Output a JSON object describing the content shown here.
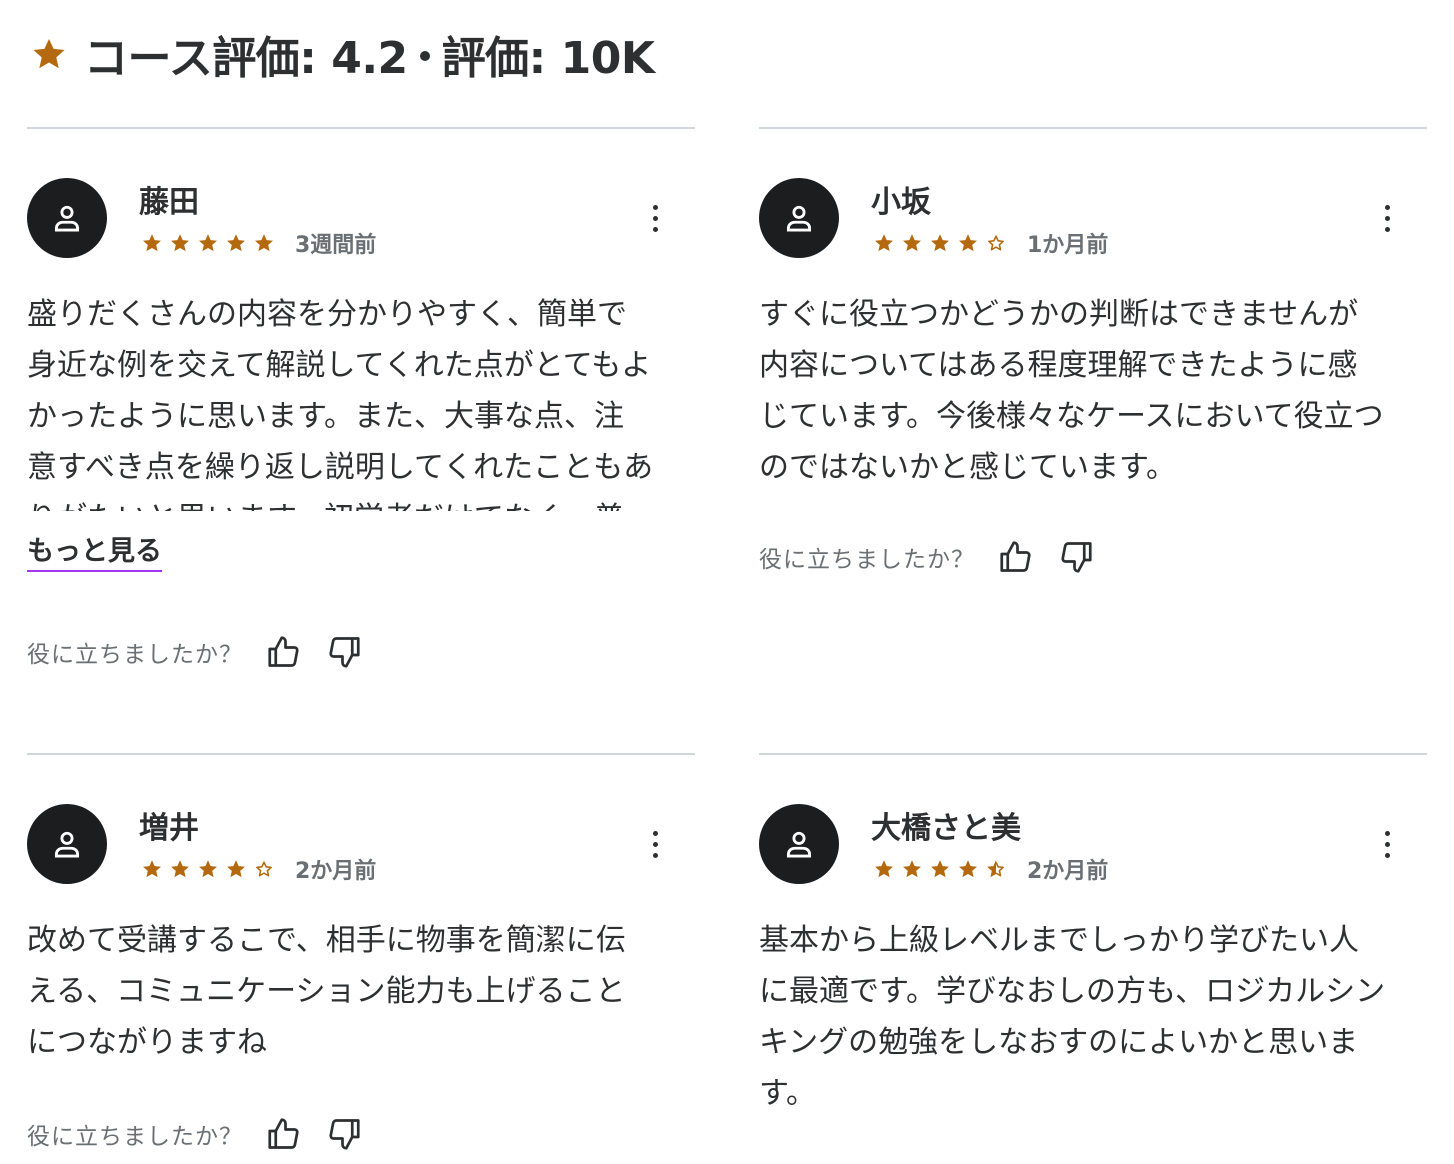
{
  "header": {
    "title_rating": "コース評価: 4.2",
    "title_count": "評価: 10K"
  },
  "colors": {
    "star": "#b4690e",
    "avatar_bg": "#1c1d1f",
    "link_underline": "#a435f0"
  },
  "reviews": [
    {
      "name": "藤田",
      "rating": 5,
      "date": "3週間前",
      "body": "盛りだくさんの内容を分かりやすく、簡単で\n身近な例を交えて解説してくれた点がとてもよ\nかったように思います。また、大事な点、注\n意すべき点を繰り返し説明してくれたこともあ\nりがたいと思います。初学者だけでなく、普",
      "show_more": "もっと見る",
      "helpful_label": "役に立ちましたか？"
    },
    {
      "name": "小坂",
      "rating": 4,
      "date": "1か月前",
      "body": "すぐに役立つかどうかの判断はできませんが\n内容についてはある程度理解できたように感\nじています。今後様々なケースにおいて役立つ\nのではないかと感じています。",
      "helpful_label": "役に立ちましたか？"
    },
    {
      "name": "増井",
      "rating": 4,
      "date": "2か月前",
      "body": "改めて受講するこで、相手に物事を簡潔に伝\nえる、コミュニケーション能力も上げること\nにつながりますね",
      "helpful_label": "役に立ちましたか？"
    },
    {
      "name": "大橋さと美",
      "rating": 4.5,
      "date": "2か月前",
      "body": "基本から上級レベルまでしっかり学びたい人\nに最適です。学びなおしの方も、ロジカルシン\nキングの勉強をしなおすのによいかと思いま\nす。"
    }
  ],
  "icons": {
    "header_star": "star-icon",
    "avatar": "user-icon",
    "more": "kebab-menu-icon",
    "thumbs_up": "thumbs-up-icon",
    "thumbs_down": "thumbs-down-icon"
  }
}
